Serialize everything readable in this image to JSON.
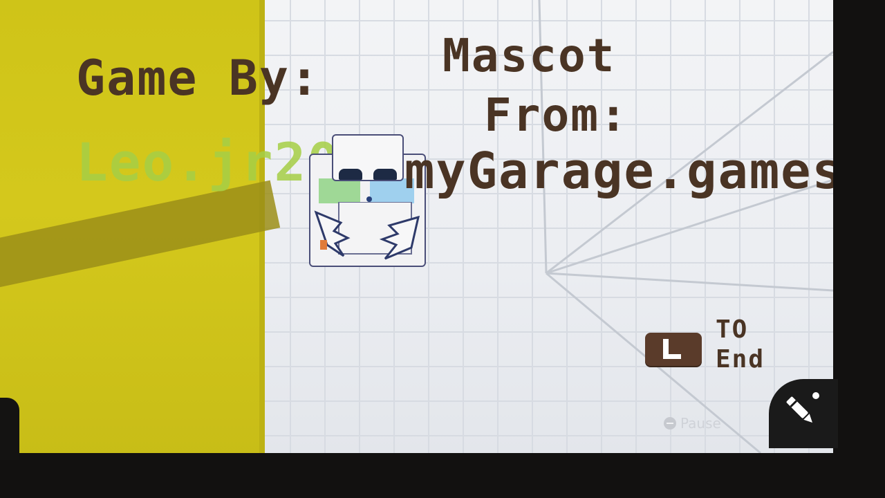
{
  "credits": {
    "label": "Game By:",
    "author": "Leo.jr2009"
  },
  "mascot": {
    "title": "Mascot",
    "from": "From:",
    "source": "myGarage.games"
  },
  "controls": {
    "end_button": "L",
    "end_label": "TO\nEnd",
    "pause_hint": "Pause"
  },
  "colors": {
    "wall": "#d4c81c",
    "text": "#4a3424",
    "author": "#a6cf46",
    "button": "#5a3b2a"
  },
  "icons": [
    "l-button-icon",
    "minus-icon",
    "pencil-icon"
  ]
}
